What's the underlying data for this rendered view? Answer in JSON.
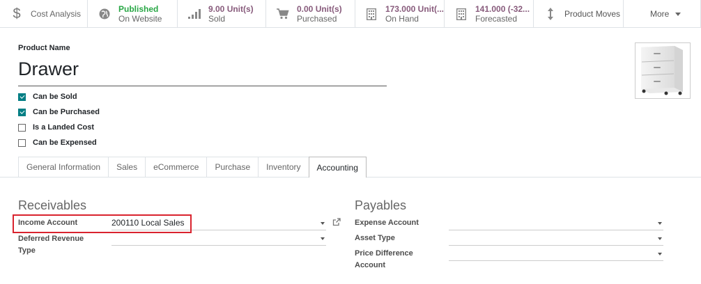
{
  "smart_buttons": {
    "cost_analysis": "Cost Analysis",
    "published_value": "Published",
    "published_label": "On Website",
    "sold_value": "9.00 Unit(s)",
    "sold_label": "Sold",
    "purchased_value": "0.00 Unit(s)",
    "purchased_label": "Purchased",
    "onhand_value": "173.000 Unit(...",
    "onhand_label": "On Hand",
    "forecast_value": "141.000 (-32...",
    "forecast_label": "Forecasted",
    "product_moves": "Product Moves",
    "more": "More"
  },
  "product": {
    "name_label": "Product Name",
    "name": "Drawer",
    "checkboxes": [
      {
        "label": "Can be Sold",
        "checked": true
      },
      {
        "label": "Can be Purchased",
        "checked": true
      },
      {
        "label": "Is a Landed Cost",
        "checked": false
      },
      {
        "label": "Can be Expensed",
        "checked": false
      }
    ]
  },
  "tabs": [
    "General Information",
    "Sales",
    "eCommerce",
    "Purchase",
    "Inventory",
    "Accounting"
  ],
  "active_tab": "Accounting",
  "receivables": {
    "title": "Receivables",
    "income_account_label": "Income Account",
    "income_account_value": "200110 Local Sales",
    "deferred_label_1": "Deferred Revenue",
    "deferred_label_2": "Type",
    "deferred_value": ""
  },
  "payables": {
    "title": "Payables",
    "expense_account_label": "Expense Account",
    "asset_type_label": "Asset Type",
    "price_diff_label_1": "Price Difference",
    "price_diff_label_2": "Account"
  },
  "colors": {
    "accent": "#875a7b",
    "published": "#28a745",
    "checkbox": "#017e84",
    "highlight": "#d9232e"
  },
  "icons": [
    "dollar-icon",
    "globe-icon",
    "signal-icon",
    "cart-icon",
    "building-icon",
    "building-icon",
    "arrows-vertical-icon",
    "caret-down-icon",
    "external-link-icon"
  ]
}
